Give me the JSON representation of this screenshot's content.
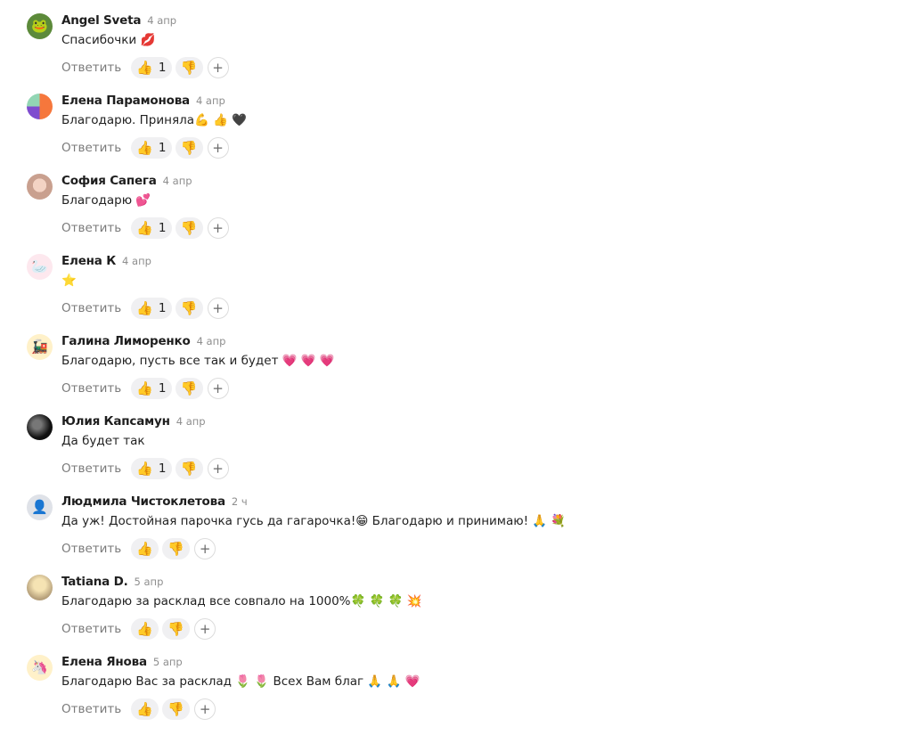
{
  "labels": {
    "reply": "Ответить",
    "add_reaction": "+"
  },
  "icons": {
    "thumbs_up": "👍",
    "thumbs_down": "👎"
  },
  "comments": [
    {
      "author": "Angel Sveta",
      "date": "4 апр",
      "text": "Спасибочки 💋",
      "likes": "1",
      "avatar": "🐸"
    },
    {
      "author": "Елена Парамонова",
      "date": "4 апр",
      "text": "Благодарю. Приняла💪 👍 🖤",
      "likes": "1",
      "avatar": ""
    },
    {
      "author": "София Сапега",
      "date": "4 апр",
      "text": "Благодарю 💕",
      "likes": "1",
      "avatar": ""
    },
    {
      "author": "Елена К",
      "date": "4 апр",
      "text": "⭐",
      "likes": "1",
      "avatar": "🦢"
    },
    {
      "author": "Галина Лиморенко",
      "date": "4 апр",
      "text": "Благодарю, пусть все так и будет 💗 💗 💗",
      "likes": "1",
      "avatar": "🚂"
    },
    {
      "author": "Юлия Капсамун",
      "date": "4 апр",
      "text": "Да будет так",
      "likes": "1",
      "avatar": ""
    },
    {
      "author": "Людмила Чистоклетова",
      "date": "2 ч",
      "text": "Да уж! Достойная парочка гусь да гагарочка!😁 Благодарю и принимаю! 🙏 💐",
      "likes": "",
      "avatar": "👤"
    },
    {
      "author": "Tatiana D.",
      "date": "5 апр",
      "text": "Благодарю за расклад все совпало на 1000%🍀 🍀 🍀 💥",
      "likes": "",
      "avatar": ""
    },
    {
      "author": "Елена Янова",
      "date": "5 апр",
      "text": "Благодарю Вас за расклад  🌷 🌷  Всех Вам благ 🙏 🙏 💗",
      "likes": "",
      "avatar": "🦄"
    }
  ]
}
